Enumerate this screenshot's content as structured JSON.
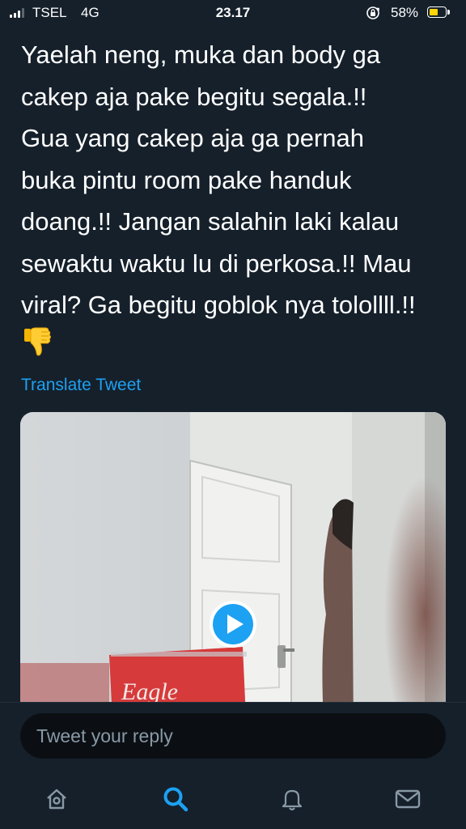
{
  "status_bar": {
    "carrier": "TSEL",
    "network": "4G",
    "time": "23.17",
    "battery_percent": "58%",
    "battery_level": 0.58,
    "icons": [
      "signal-icon",
      "orientation-lock-icon",
      "battery-icon"
    ]
  },
  "tweet": {
    "text": "Yaelah neng, muka dan body ga\ncakep aja pake begitu segala.!!\nGua yang cakep aja ga pernah\nbuka pintu room pake handuk\ndoang.!! Jangan salahin laki kalau\nsewaktu waktu lu di perkosa.!! Mau\nviral? Ga begitu goblok nya tolollll.!!",
    "emoji": "thumbs-down-icon",
    "translate_label": "Translate Tweet",
    "media": {
      "type": "video",
      "play_icon": "play-icon",
      "signage_text": "Eagle"
    }
  },
  "reply": {
    "placeholder": "Tweet your reply"
  },
  "tab_bar": {
    "tabs": [
      {
        "icon": "home-icon",
        "active": false
      },
      {
        "icon": "search-icon",
        "active": true
      },
      {
        "icon": "notifications-icon",
        "active": false
      },
      {
        "icon": "messages-icon",
        "active": false
      }
    ]
  },
  "colors": {
    "background": "#15202b",
    "accent": "#1da1f2",
    "text": "#ffffff",
    "muted": "#8899a6",
    "battery": "#ffd60a"
  }
}
